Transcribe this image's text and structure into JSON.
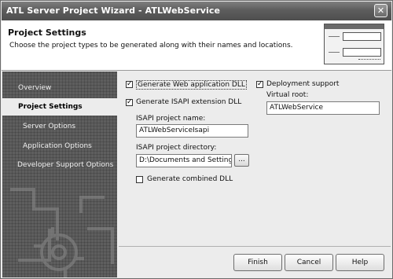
{
  "window": {
    "title": "ATL Server Project Wizard - ATLWebService",
    "close_glyph": "✕"
  },
  "header": {
    "title": "Project Settings",
    "description": "Choose the project types to be generated along with their names and locations.",
    "thumbnail_icon": "wizard-preview-icon"
  },
  "sidebar": {
    "items": [
      {
        "label": "Overview",
        "active": false
      },
      {
        "label": "Project Settings",
        "active": true
      },
      {
        "label": "Server Options",
        "active": false
      },
      {
        "label": "Application Options",
        "active": false
      },
      {
        "label": "Developer Support Options",
        "active": false
      }
    ]
  },
  "settings": {
    "generate_web_app_dll": {
      "label": "Generate Web application DLL",
      "checked": true
    },
    "generate_isapi_ext_dll": {
      "label": "Generate ISAPI extension DLL",
      "checked": true
    },
    "isapi_project_name": {
      "label": "ISAPI project name:",
      "value": "ATLWebServiceIsapi"
    },
    "isapi_project_directory": {
      "label": "ISAPI project directory:",
      "value": "D:\\Documents and Settings\\ma",
      "browse_label": "..."
    },
    "generate_combined_dll": {
      "label": "Generate combined DLL",
      "checked": false
    },
    "deployment_support": {
      "label": "Deployment support",
      "checked": true
    },
    "virtual_root": {
      "label": "Virtual root:",
      "value": "ATLWebService"
    }
  },
  "footer": {
    "finish_label": "Finish",
    "cancel_label": "Cancel",
    "help_label": "Help"
  },
  "colors": {
    "titlebar": "#5d5d5d",
    "sidebar": "#5e5e5e",
    "dialog_bg": "#ececec"
  }
}
